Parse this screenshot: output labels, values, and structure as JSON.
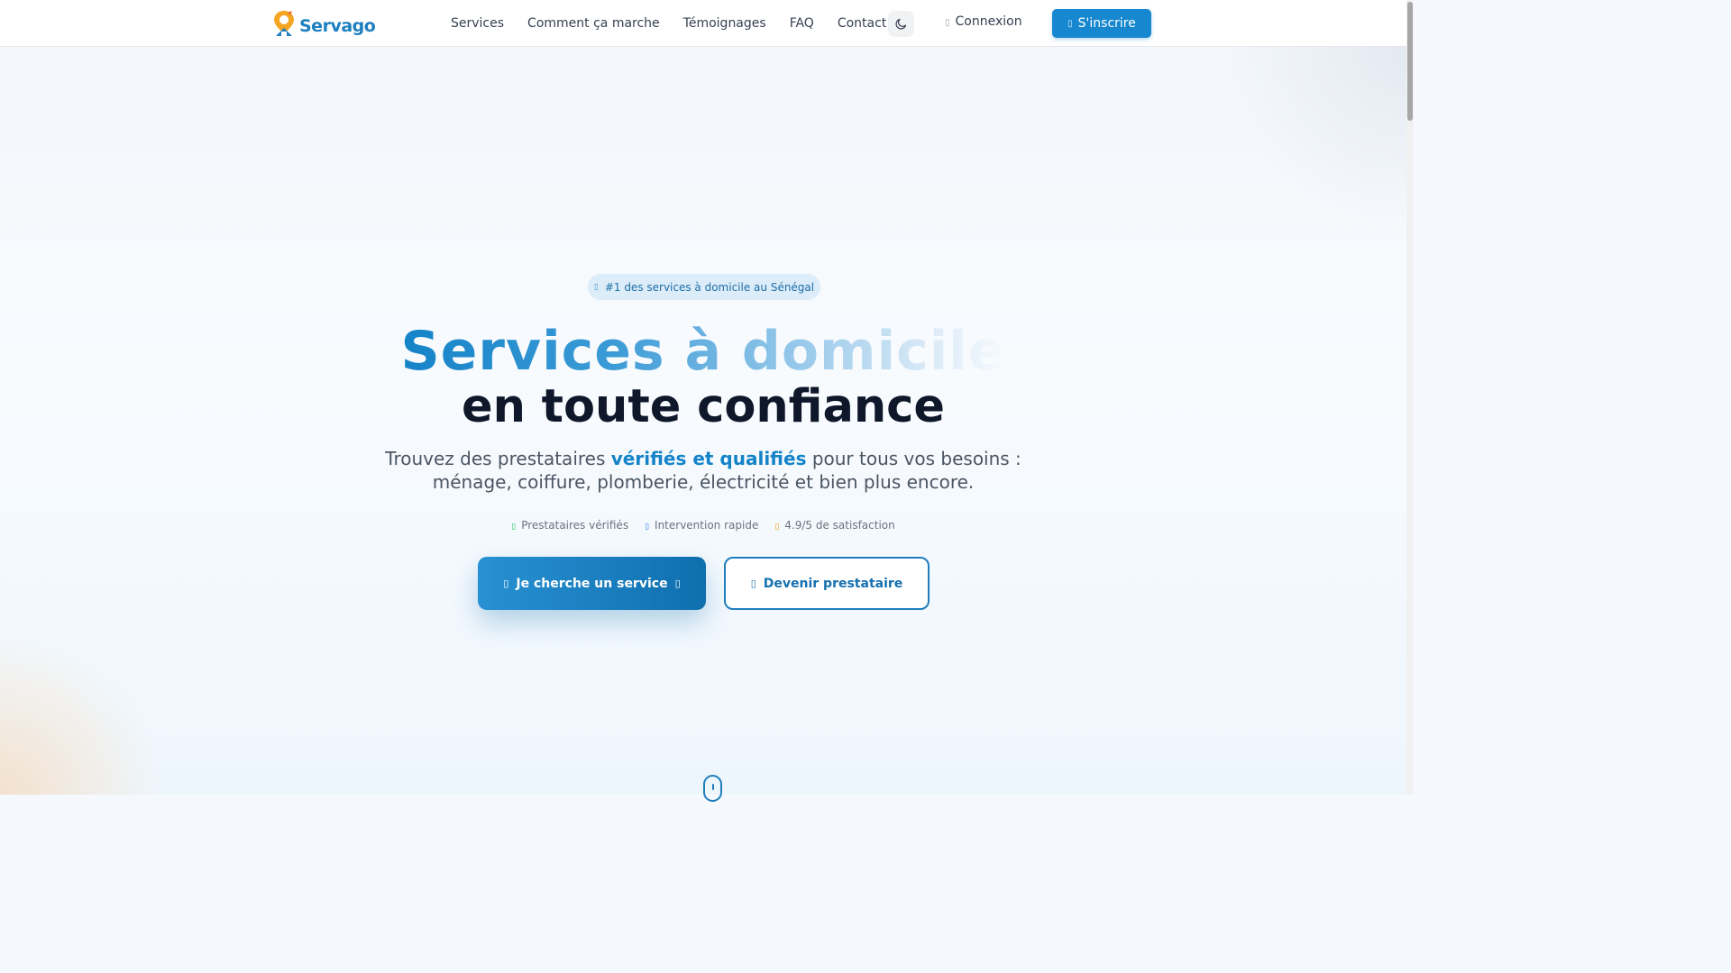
{
  "brand": {
    "name": "Servago",
    "primary_color": "#1787cf",
    "text_color": "#0f172a"
  },
  "nav": {
    "items": [
      {
        "label": "Services"
      },
      {
        "label": "Comment ça marche"
      },
      {
        "label": "Témoignages"
      },
      {
        "label": "FAQ"
      },
      {
        "label": "Contact"
      }
    ],
    "theme_toggle_icon": "moon-icon",
    "login_label": "Connexion",
    "login_icon": "login-icon",
    "signup_label": "S'inscrire",
    "signup_icon": "user-plus-icon"
  },
  "hero": {
    "badge": "#1 des services à domicile au Sénégal",
    "badge_icon": "sparkle-icon",
    "title_line1": "Services à domicile",
    "title_line2": "en toute confiance",
    "subtitle_before": "Trouvez des prestataires ",
    "subtitle_highlight": "vérifiés et qualifiés",
    "subtitle_after": " pour tous vos besoins : ménage, coiffure, plomberie, électricité et bien plus encore.",
    "features": [
      {
        "label": "Prestataires vérifiés",
        "icon": "check-circle-icon",
        "color": "#22c55e"
      },
      {
        "label": "Intervention rapide",
        "icon": "clock-icon",
        "color": "#3b82f6"
      },
      {
        "label": "4.9/5 de satisfaction",
        "icon": "star-icon",
        "color": "#f59e0b"
      }
    ],
    "primary_cta": "Je cherche un service",
    "primary_cta_icon": "search-icon",
    "secondary_cta": "Devenir prestataire",
    "secondary_cta_icon": "briefcase-icon"
  }
}
